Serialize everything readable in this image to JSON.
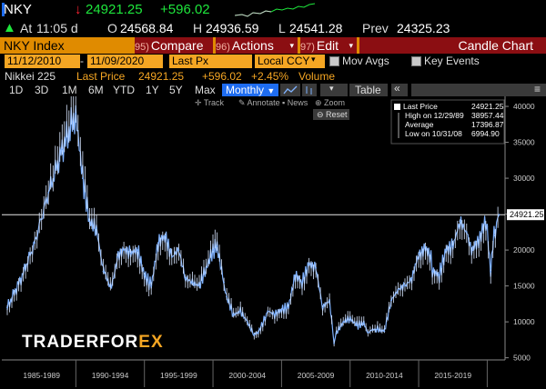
{
  "header": {
    "ticker": "NKY",
    "last": "24921.25",
    "change": "+596.02",
    "at_label": "At",
    "time": "11:05 d",
    "open_label": "O",
    "open": "24568.84",
    "high_label": "H",
    "high": "24936.59",
    "low_label": "L",
    "low": "24541.28",
    "prev_label": "Prev",
    "prev": "24325.23"
  },
  "menu": {
    "title": "NKY Index",
    "compare_num": "95)",
    "compare": "Compare",
    "actions_num": "96)",
    "actions": "Actions",
    "edit_num": "97)",
    "edit": "Edit",
    "chart_type": "Candle Chart"
  },
  "controls": {
    "start_date": "11/12/2010",
    "end_date": "11/09/2020",
    "field": "Last Px",
    "currency": "Local CCY",
    "mov_avgs": "Mov Avgs",
    "key_events": "Key Events"
  },
  "info": {
    "security": "Nikkei 225",
    "last_label": "Last Price",
    "last_value": "24921.25",
    "change": "+596.02",
    "pct": "+2.45%",
    "volume_label": "Volume"
  },
  "toolbar": {
    "periods": [
      "1D",
      "3D",
      "1M",
      "6M",
      "YTD",
      "1Y",
      "5Y",
      "Max"
    ],
    "frequency": "Monthly",
    "table": "Table"
  },
  "tools": {
    "track": "Track",
    "annotate": "Annotate",
    "news": "News",
    "zoom": "Zoom",
    "reset": "Reset"
  },
  "legend": {
    "last_label": "Last Price",
    "last_value": "24921.25",
    "high_label": "High on 12/29/89",
    "high_value": "38957.44",
    "avg_label": "Average",
    "avg_value": "17396.87",
    "low_label": "Low on 10/31/08",
    "low_value": "6994.90",
    "price_tag": "24921.25"
  },
  "watermark": {
    "part1": "TRADERFOR",
    "part2": "EX"
  },
  "colors": {
    "series": "#7fb2ff",
    "accent_orange": "#e08b00",
    "button_red": "#8b0e12",
    "up_green": "#1ee63c"
  },
  "chart_data": {
    "type": "line",
    "series": [
      {
        "name": "Last Price",
        "x": [
          1985,
          1986,
          1987,
          1988,
          1989,
          1989.99,
          1990.5,
          1991,
          1991.5,
          1992,
          1992.6,
          1993,
          1993.5,
          1994,
          1994.5,
          1995,
          1995.5,
          1996,
          1996.5,
          1997,
          1997.5,
          1998,
          1998.5,
          1999,
          1999.5,
          2000,
          2000.3,
          2000.8,
          2001,
          2001.5,
          2002,
          2002.5,
          2003,
          2003.3,
          2003.8,
          2004,
          2004.5,
          2005,
          2005.5,
          2006,
          2006.5,
          2007,
          2007.5,
          2008,
          2008.5,
          2008.83,
          2009,
          2009.5,
          2010,
          2010.5,
          2011,
          2011.3,
          2011.9,
          2012,
          2012.5,
          2013,
          2013.5,
          2014,
          2014.5,
          2015,
          2015.4,
          2015.9,
          2016,
          2016.5,
          2017,
          2017.5,
          2018,
          2018.5,
          2018.95,
          2019.3,
          2019.9,
          2020,
          2020.25,
          2020.5,
          2020.87
        ],
        "y": [
          12000,
          16000,
          21000,
          28000,
          34000,
          38957,
          30000,
          24000,
          23000,
          17000,
          15000,
          19000,
          20000,
          19500,
          20000,
          16500,
          15000,
          21000,
          22000,
          19000,
          20000,
          16000,
          15500,
          15000,
          17500,
          20000,
          20500,
          15500,
          13500,
          11000,
          11500,
          10000,
          8200,
          8500,
          10500,
          11500,
          11000,
          11700,
          12000,
          16500,
          15500,
          18000,
          17500,
          12000,
          13000,
          6995,
          8500,
          10000,
          10500,
          9500,
          9800,
          8500,
          8900,
          9000,
          8700,
          13000,
          14500,
          15000,
          16000,
          19500,
          20500,
          19000,
          17000,
          16500,
          20000,
          20500,
          24000,
          22500,
          20000,
          21500,
          23500,
          23300,
          17000,
          22000,
          24921
        ]
      }
    ],
    "xlabel": "",
    "ylabel": "",
    "x_tick_labels": [
      "1985-1989",
      "1990-1994",
      "1995-1999",
      "2000-2004",
      "2005-2009",
      "2010-2014",
      "2015-2019"
    ],
    "y_ticks": [
      5000,
      10000,
      15000,
      20000,
      25000,
      30000,
      35000,
      40000
    ],
    "xlim": [
      1984.6,
      2021.3
    ],
    "ylim": [
      4700,
      41400
    ],
    "reference_line": 24921.25,
    "grid": false,
    "legend": "top-right"
  }
}
